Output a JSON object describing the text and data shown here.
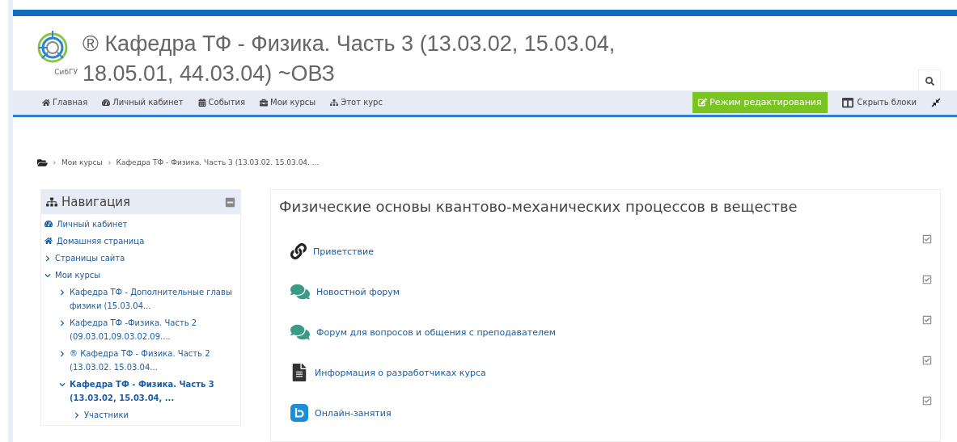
{
  "header": {
    "logo_text": "СибГУ",
    "title_lines": [
      "® Кафедра ТФ - Физика. Часть 3 (13.03.02, 15.03.04,",
      "18.05.01, 44.03.04) ~ОВЗ"
    ]
  },
  "navbar": {
    "items": [
      {
        "kind": "home",
        "label": "Главная"
      },
      {
        "kind": "dashboard",
        "label": "Личный кабинет"
      },
      {
        "kind": "calendar",
        "label": "События"
      },
      {
        "kind": "briefcase",
        "label": "Мои курсы"
      },
      {
        "kind": "sitemap",
        "label": "Этот курс"
      }
    ],
    "edit_button": "Режим редактирования",
    "hide_blocks": "Скрыть блоки"
  },
  "breadcrumb": [
    "Мои курсы",
    "Кафедра ТФ - Физика. Часть 3 (13.03.02. 15.03.04. ..."
  ],
  "navigation": {
    "title": "Навигация",
    "items": [
      {
        "kind": "dashboard",
        "label": "Личный кабинет"
      },
      {
        "kind": "home",
        "label": "Домашняя страница"
      },
      {
        "kind": "branch",
        "label": "Страницы сайта",
        "expanded": false,
        "current": false
      },
      {
        "kind": "branch",
        "label": "Мои курсы",
        "expanded": true,
        "current": false,
        "children": [
          {
            "kind": "branch",
            "label": "Кафедра ТФ - Дополнительные главы физики (15.03.04...",
            "expanded": false,
            "current": false
          },
          {
            "kind": "branch",
            "label": "Кафедра ТФ -Физика. Часть 2 (09.03.01,09.03.02.09....",
            "expanded": false,
            "current": false
          },
          {
            "kind": "branch",
            "label": "® Кафедра ТФ - Физика. Часть 2 (13.03.02. 15.03.04...",
            "expanded": false,
            "current": false
          },
          {
            "kind": "branch",
            "label": "Кафедра ТФ - Физика. Часть 3 (13.03.02, 15.03.04, ...",
            "expanded": true,
            "current": true,
            "children": [
              {
                "kind": "branch",
                "label": "Участники",
                "expanded": false,
                "current": false
              }
            ]
          }
        ]
      }
    ]
  },
  "section": {
    "title": "Физические основы квантово-механических процессов в веществе",
    "activities": [
      {
        "kind": "url",
        "name": "Приветствие",
        "completed": true
      },
      {
        "kind": "forum",
        "name": "Новостной форум",
        "completed": true
      },
      {
        "kind": "forum",
        "name": "Форум для вопросов и общения с преподавателем",
        "completed": true
      },
      {
        "kind": "page",
        "name": "Информация о разработчиках курса",
        "completed": true
      },
      {
        "kind": "bbb",
        "name": "Онлайн-занятия",
        "completed": true
      }
    ]
  }
}
